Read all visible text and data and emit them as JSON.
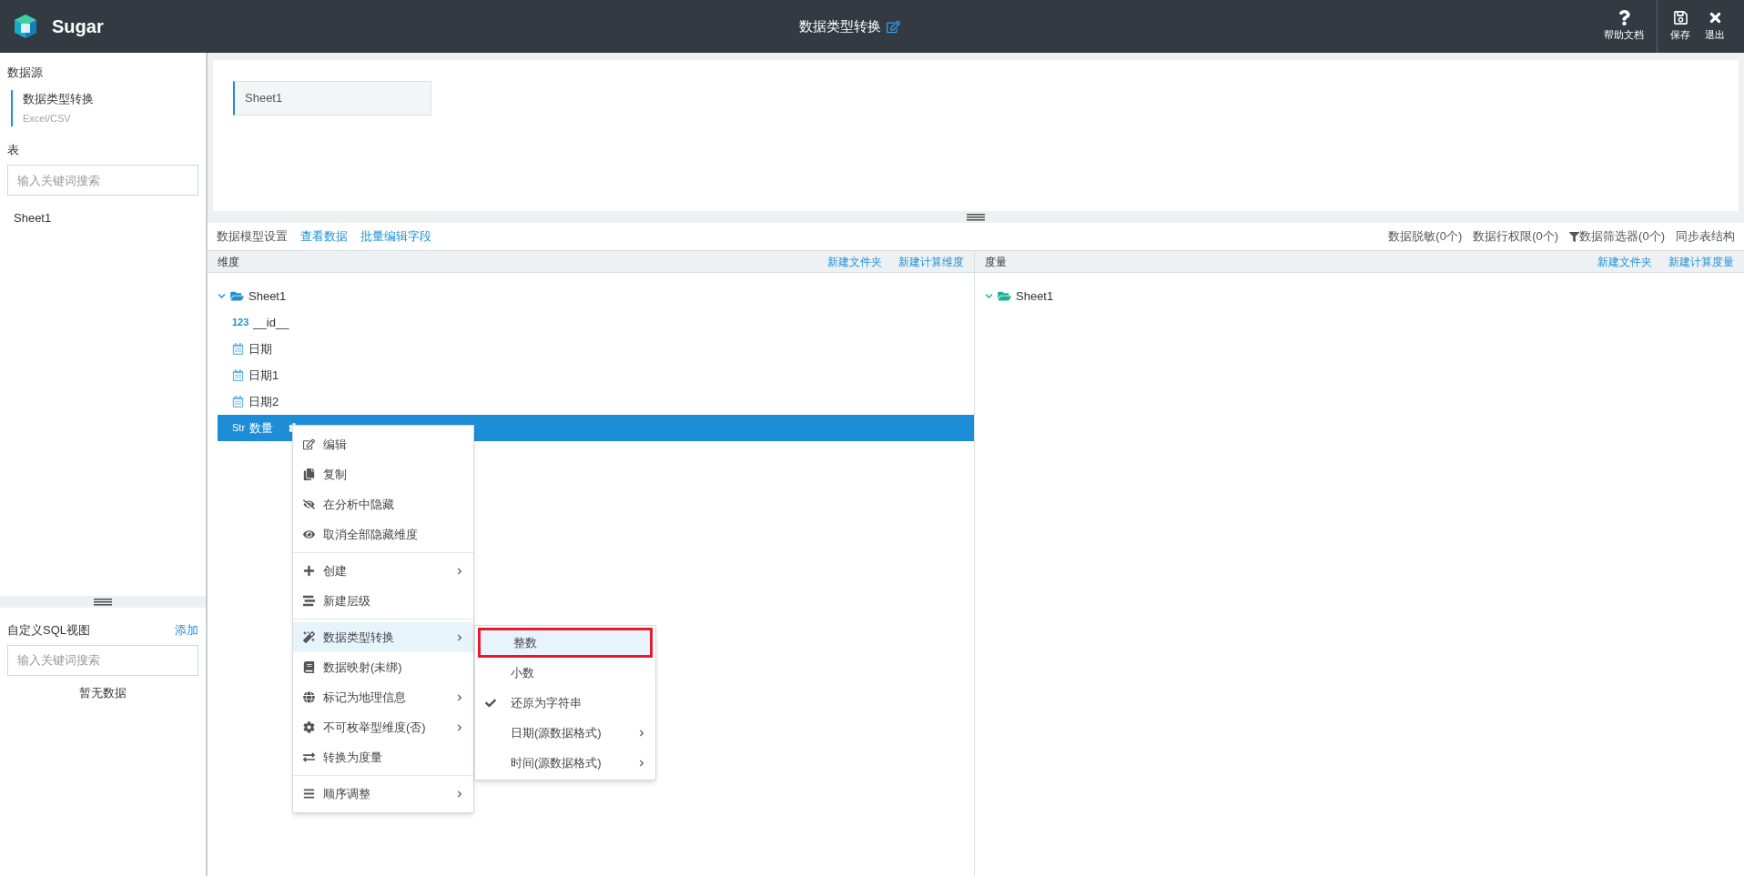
{
  "app": {
    "name": "Sugar"
  },
  "header": {
    "title": "数据类型转换",
    "actions": [
      {
        "label": "帮助文档"
      },
      {
        "label": "保存"
      },
      {
        "label": "退出"
      }
    ]
  },
  "sidebar": {
    "datasource_heading": "数据源",
    "datasource": {
      "name": "数据类型转换",
      "type": "Excel/CSV",
      "selected": true
    },
    "tables_heading": "表",
    "table_search": {
      "placeholder": "输入关键词搜索"
    },
    "tables": [
      {
        "name": "Sheet1",
        "selected": false
      }
    ],
    "sql_views": {
      "title": "自定义SQL视图",
      "add": "添加",
      "search": {
        "placeholder": "输入关键词搜索"
      },
      "empty": "暂无数据"
    }
  },
  "tabs": [
    {
      "label": "Sheet1",
      "selected": true
    }
  ],
  "toolbar": {
    "links": [
      {
        "label": "数据模型设置",
        "selected": true
      },
      {
        "label": "查看数据",
        "selected": false
      },
      {
        "label": "批量编辑字段",
        "selected": false
      }
    ],
    "actions": [
      {
        "label": "数据脱敏(0个)",
        "kind": "text"
      },
      {
        "label": "数据行权限(0个)",
        "kind": "text"
      },
      {
        "label": "数据筛选器(0个)",
        "kind": "filter"
      },
      {
        "label": "同步表结构",
        "kind": "text"
      }
    ]
  },
  "dimensions": {
    "title": "维度",
    "actions": [
      "新建文件夹",
      "新建计算维度"
    ],
    "tree": [
      {
        "name": "Sheet1",
        "expanded": true,
        "children": [
          {
            "name": "__id__",
            "kind": "number",
            "type_label": "123",
            "selected": false
          },
          {
            "name": "日期",
            "kind": "date",
            "selected": false
          },
          {
            "name": "日期1",
            "kind": "date",
            "selected": false
          },
          {
            "name": "日期2",
            "kind": "date",
            "selected": false
          },
          {
            "name": "数量",
            "kind": "string",
            "type_label": "Str",
            "selected": true
          }
        ]
      }
    ]
  },
  "measures": {
    "title": "度量",
    "actions": [
      "新建文件夹",
      "新建计算度量"
    ],
    "tree": [
      {
        "name": "Sheet1",
        "expanded": true
      }
    ]
  },
  "context_menu": {
    "groups": [
      [
        {
          "label": "编辑",
          "submenu": false,
          "selected": false
        },
        {
          "label": "复制",
          "submenu": false,
          "selected": false
        },
        {
          "label": "在分析中隐藏",
          "submenu": false,
          "selected": false
        },
        {
          "label": "取消全部隐藏维度",
          "submenu": false,
          "selected": false
        }
      ],
      [
        {
          "label": "创建",
          "submenu": true,
          "selected": false
        },
        {
          "label": "新建层级",
          "submenu": false,
          "selected": false
        }
      ],
      [
        {
          "label": "数据类型转换",
          "submenu": true,
          "selected": true
        },
        {
          "label": "数据映射(未绑)",
          "submenu": false,
          "selected": false
        },
        {
          "label": "标记为地理信息",
          "submenu": true,
          "selected": false
        },
        {
          "label": "不可枚举型维度(否)",
          "submenu": true,
          "selected": false
        },
        {
          "label": "转换为度量",
          "submenu": false,
          "selected": false
        }
      ],
      [
        {
          "label": "顺序调整",
          "submenu": true,
          "selected": false
        }
      ]
    ]
  },
  "submenu": {
    "items": [
      {
        "label": "整数",
        "checked": false,
        "submenu": false,
        "selected": true,
        "outlined": true
      },
      {
        "label": "小数",
        "checked": false,
        "submenu": false,
        "selected": false,
        "outlined": false
      },
      {
        "label": "还原为字符串",
        "checked": true,
        "submenu": false,
        "selected": false,
        "outlined": false
      },
      {
        "label": "日期(源数据格式)",
        "checked": false,
        "submenu": true,
        "selected": false,
        "outlined": false
      },
      {
        "label": "时间(源数据格式)",
        "checked": false,
        "submenu": true,
        "selected": false,
        "outlined": false
      }
    ]
  }
}
